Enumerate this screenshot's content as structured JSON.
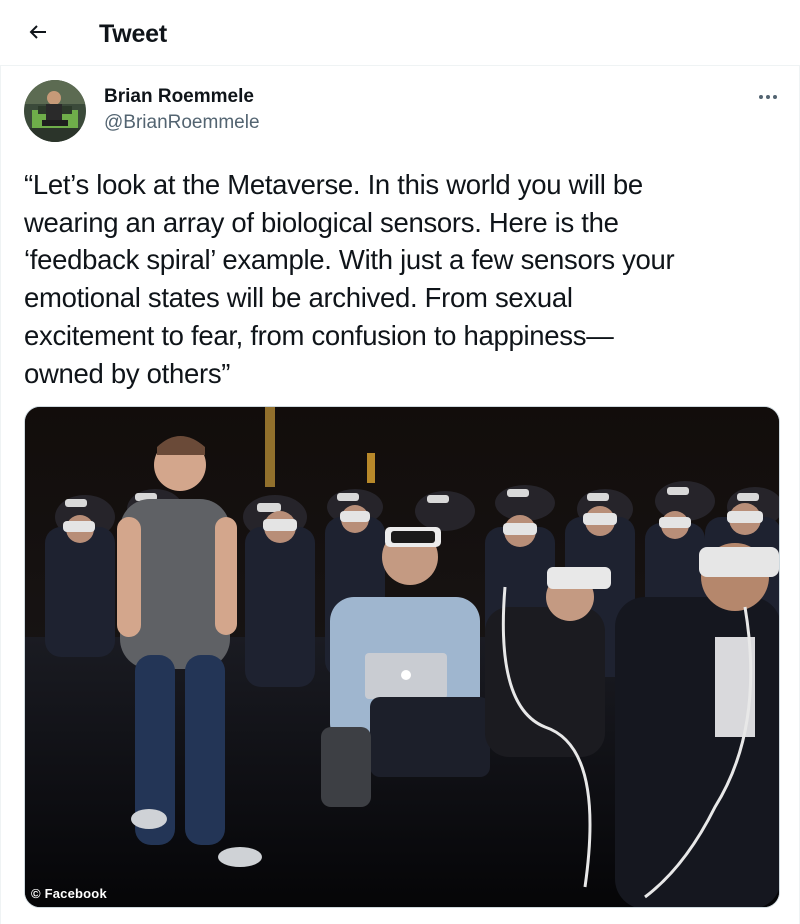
{
  "header": {
    "title": "Tweet",
    "back_icon": "arrow-left-icon"
  },
  "tweet": {
    "author": {
      "display_name": "Brian Roemmele",
      "handle": "@BrianRoemmele",
      "avatar_icon": "avatar-photo"
    },
    "more_icon": "more-dots-icon",
    "text": "“Let’s look at the Metaverse. In this world you will be\nwearing an array of biological sensors. Here is the\n‘feedback spiral’ example. With just a few sensors your\nemotional states will be archived. From sexual\nexcitement to fear, from confusion to happiness—\nowned by others”",
    "media": {
      "watermark": "© Facebook",
      "description_icon": "vr-audience-photo"
    }
  },
  "colors": {
    "text_primary": "#0f1419",
    "text_secondary": "#536471",
    "border": "#eff3f4",
    "media_border": "#cfd9de"
  }
}
